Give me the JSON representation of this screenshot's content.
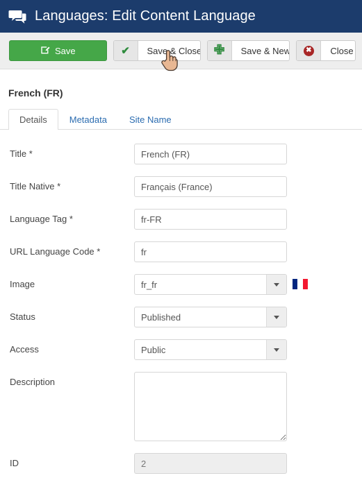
{
  "header": {
    "icon": "speech-bubbles-icon",
    "title": "Languages: Edit Content Language",
    "bg_color": "#1c3c6c"
  },
  "toolbar": {
    "buttons": [
      {
        "name": "save",
        "label": "Save",
        "icon": "pencil-square-icon",
        "style": "primary",
        "color": "#45a748"
      },
      {
        "name": "save-close",
        "label": "Save & Close",
        "icon": "check-icon",
        "style": "default"
      },
      {
        "name": "save-new",
        "label": "Save & New",
        "icon": "plus-icon",
        "style": "default"
      },
      {
        "name": "close",
        "label": "Close",
        "icon": "circle-x-icon",
        "style": "default"
      }
    ]
  },
  "page": {
    "title": "French (FR)"
  },
  "tabs": [
    {
      "label": "Details",
      "active": true
    },
    {
      "label": "Metadata",
      "active": false
    },
    {
      "label": "Site Name",
      "active": false
    }
  ],
  "form": {
    "title": {
      "label": "Title",
      "required": "*",
      "value": "French (FR)",
      "placeholder": ""
    },
    "title_native": {
      "label": "Title Native",
      "required": "*",
      "value": "Français (France)",
      "placeholder": ""
    },
    "language_tag": {
      "label": "Language Tag",
      "required": "*",
      "value": "fr-FR",
      "placeholder": ""
    },
    "url_language_code": {
      "label": "URL Language Code",
      "required": "*",
      "value": "fr",
      "placeholder": ""
    },
    "image": {
      "label": "Image",
      "value": "fr_fr",
      "flag": "france-flag-icon",
      "caret": "chevron-down-icon"
    },
    "status": {
      "label": "Status",
      "value": "Published",
      "caret": "chevron-down-icon"
    },
    "access": {
      "label": "Access",
      "value": "Public",
      "caret": "chevron-down-icon"
    },
    "description": {
      "label": "Description",
      "value": "",
      "placeholder": ""
    },
    "id": {
      "label": "ID",
      "value": "2",
      "disabled": true
    }
  },
  "cursor": {
    "type": "pointing-hand-cursor"
  }
}
